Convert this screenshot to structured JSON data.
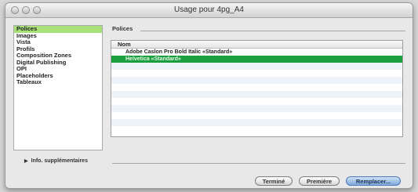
{
  "window": {
    "title": "Usage pour 4pg_A4"
  },
  "sidebar": {
    "items": [
      {
        "label": "Polices",
        "selected": true
      },
      {
        "label": "Images",
        "selected": false
      },
      {
        "label": "Vista",
        "selected": false
      },
      {
        "label": "Profils",
        "selected": false
      },
      {
        "label": "Composition Zones",
        "selected": false
      },
      {
        "label": "Digital Publishing",
        "selected": false
      },
      {
        "label": "OPI",
        "selected": false
      },
      {
        "label": "Placeholders",
        "selected": false
      },
      {
        "label": "Tableaux",
        "selected": false
      }
    ]
  },
  "section": {
    "label": "Polices"
  },
  "table": {
    "column_header": "Nom",
    "rows": [
      {
        "name": "Adobe Caslon Pro Bold Italic «Standard»",
        "selected": false
      },
      {
        "name": "Helvetica «Standard»",
        "selected": true
      }
    ]
  },
  "expander": {
    "label": "Info. supplémentaires"
  },
  "buttons": {
    "done": "Terminé",
    "first": "Première",
    "replace": "Remplacer..."
  },
  "colors": {
    "sidebar_selection": "#a8e07a",
    "row_selection": "#1a9e3e",
    "default_button": "#7ea9dc"
  }
}
